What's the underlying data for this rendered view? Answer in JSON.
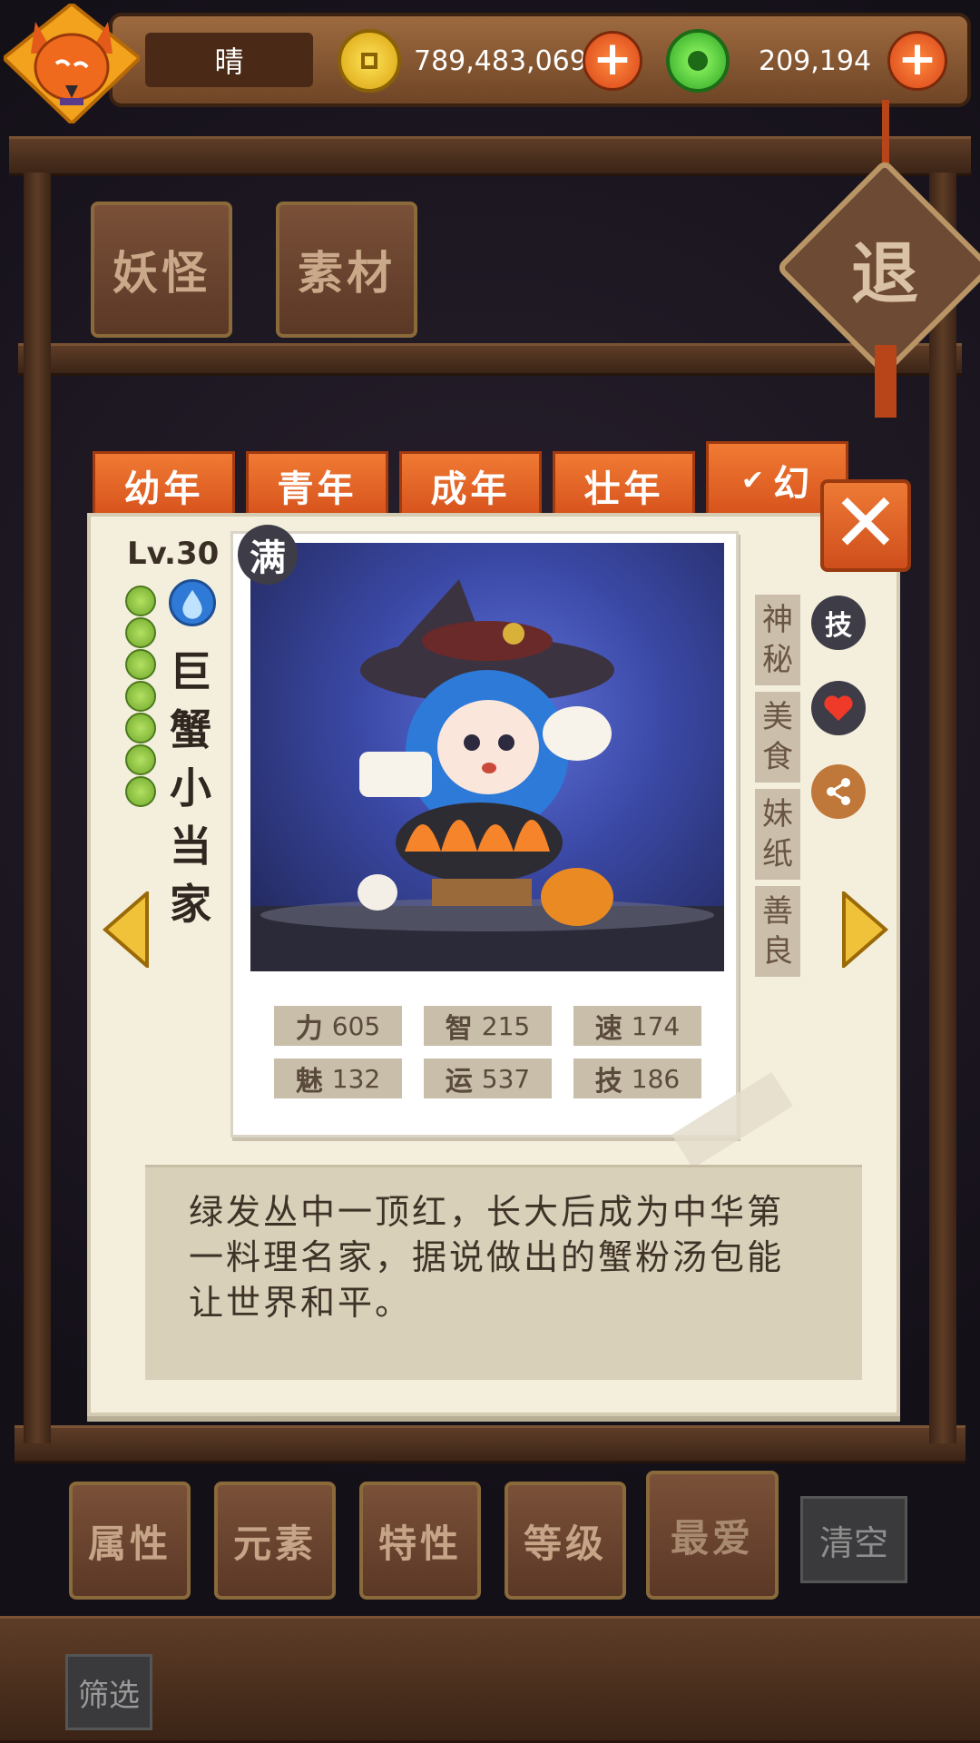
{
  "header": {
    "weather": "晴",
    "gold_amount": "789,483,069",
    "jade_amount": "209,194",
    "gold_icon": "gold-coin-icon",
    "jade_icon": "jade-ring-icon",
    "plus_label": "+"
  },
  "category_tabs": [
    "妖怪",
    "素材"
  ],
  "exit_label": "退",
  "age_tabs": [
    "幼年",
    "青年",
    "成年",
    "壮年",
    "幻"
  ],
  "card": {
    "level": "Lv.30",
    "full_badge": "满",
    "element_icon": "water-drop-icon",
    "name": "巨蟹小当家",
    "traits": [
      "神秘",
      "美食",
      "妹纸",
      "善良"
    ],
    "side_icons": {
      "skill": "技",
      "favorite": "heart-icon",
      "share": "share-icon"
    },
    "stats": [
      {
        "label": "力",
        "value": "605"
      },
      {
        "label": "智",
        "value": "215"
      },
      {
        "label": "速",
        "value": "174"
      },
      {
        "label": "魅",
        "value": "132"
      },
      {
        "label": "运",
        "value": "537"
      },
      {
        "label": "技",
        "value": "186"
      }
    ],
    "description": "绿发丛中一顶红，长大后成为中华第一料理名家，据说做出的蟹粉汤包能让世界和平。",
    "close_label": "✕",
    "growth_dots": 7
  },
  "filters": [
    "属性",
    "元素",
    "特性",
    "等级",
    "最爱"
  ],
  "clear_label": "清空",
  "screen_label": "筛选",
  "colors": {
    "accent_orange": "#e8632a",
    "card_bg": "#f4eedd",
    "wood": "#6d4a33"
  }
}
